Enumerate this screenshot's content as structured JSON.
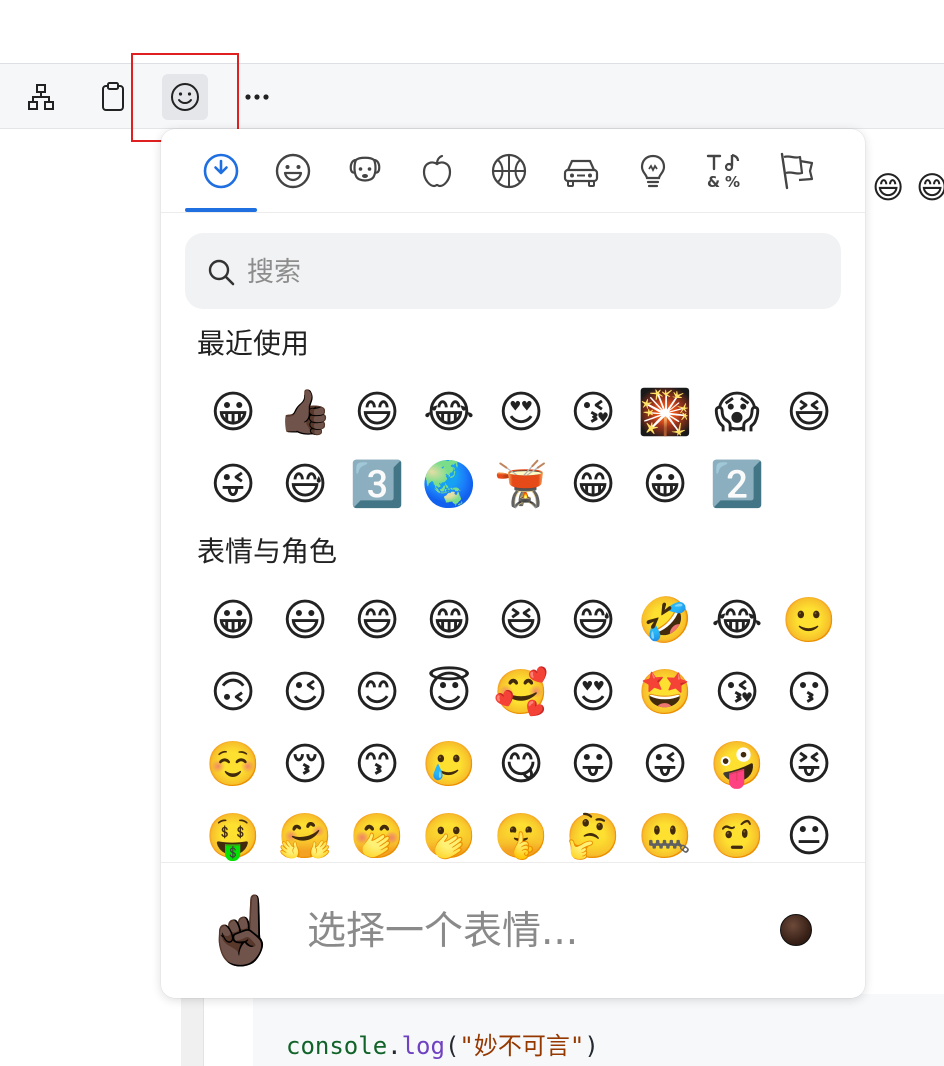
{
  "toolbar": {
    "buttons": [
      {
        "name": "sitemap-icon"
      },
      {
        "name": "clipboard-icon"
      },
      {
        "name": "smiley-icon",
        "active": true
      },
      {
        "name": "more-icon"
      }
    ]
  },
  "background_emojis": [
    "😄",
    "😄"
  ],
  "picker": {
    "category_tabs": [
      {
        "name": "recent-icon",
        "selected": true
      },
      {
        "name": "smileys-icon"
      },
      {
        "name": "animals-icon"
      },
      {
        "name": "food-icon"
      },
      {
        "name": "activities-icon"
      },
      {
        "name": "travel-icon"
      },
      {
        "name": "objects-icon"
      },
      {
        "name": "symbols-icon"
      },
      {
        "name": "flags-icon"
      }
    ],
    "search": {
      "placeholder": "搜索",
      "value": ""
    },
    "recent": {
      "title": "最近使用",
      "emojis": [
        "😀",
        "👍🏿",
        "😄",
        "😂",
        "😍",
        "😘",
        "🎇",
        "😱",
        "😆",
        "😜",
        "😅",
        "3️⃣",
        "🌏",
        "🫕",
        "😁",
        "😀",
        "2️⃣"
      ]
    },
    "smileys": {
      "title": "表情与角色",
      "emojis": [
        "😀",
        "😃",
        "😄",
        "😁",
        "😆",
        "😅",
        "🤣",
        "😂",
        "🙂",
        "🙃",
        "😉",
        "😊",
        "😇",
        "🥰",
        "😍",
        "🤩",
        "😘",
        "😗",
        "☺️",
        "😚",
        "😙",
        "🥲",
        "😋",
        "😛",
        "😜",
        "🤪",
        "😝",
        "🤑",
        "🤗",
        "🤭",
        "🫢",
        "🤫",
        "🤔",
        "🤐",
        "🤨",
        "😐",
        "😑"
      ]
    },
    "footer": {
      "preview_emoji": "☝🏿",
      "preview_text": "选择一个表情...",
      "skin_tone": "#3a2218"
    }
  },
  "code": {
    "object": "console",
    "dot": ".",
    "method": "log",
    "open": "(",
    "string": "\"妙不可言\"",
    "close": ")"
  },
  "colors": {
    "accent": "#1f6fe0",
    "highlight_box": "#e02020"
  }
}
